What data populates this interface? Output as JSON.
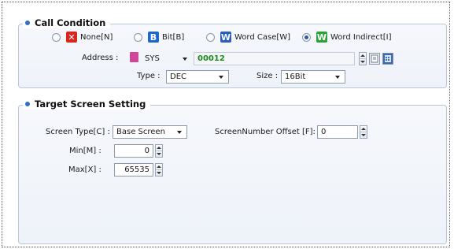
{
  "call_condition": {
    "title": "Call Condition",
    "options": [
      {
        "icon": "X",
        "label": "None[N]",
        "selected": false
      },
      {
        "icon": "B",
        "label": "Bit[B]",
        "selected": false
      },
      {
        "icon": "W",
        "label": "Word Case[W]",
        "selected": false
      },
      {
        "icon": "W",
        "label": "Word Indirect[I]",
        "selected": true
      }
    ],
    "address_label": "Address :",
    "address_device": "SYS",
    "address_value": "00012",
    "type_label": "Type :",
    "type_value": "DEC",
    "size_label": "Size :",
    "size_value": "16Bit"
  },
  "target": {
    "title": "Target Screen Setting",
    "screen_type_label": "Screen Type[C] :",
    "screen_type_value": "Base Screen",
    "offset_label": "ScreenNumber Offset [F]:",
    "offset_value": "0",
    "min_label": "Min[M] :",
    "min_value": "0",
    "max_label": "Max[X] :",
    "max_value": "65535"
  },
  "colors": {
    "bullet": "#2f6fc3",
    "address_value": "#1c8a1c",
    "group_border": "#b9c6d8"
  }
}
